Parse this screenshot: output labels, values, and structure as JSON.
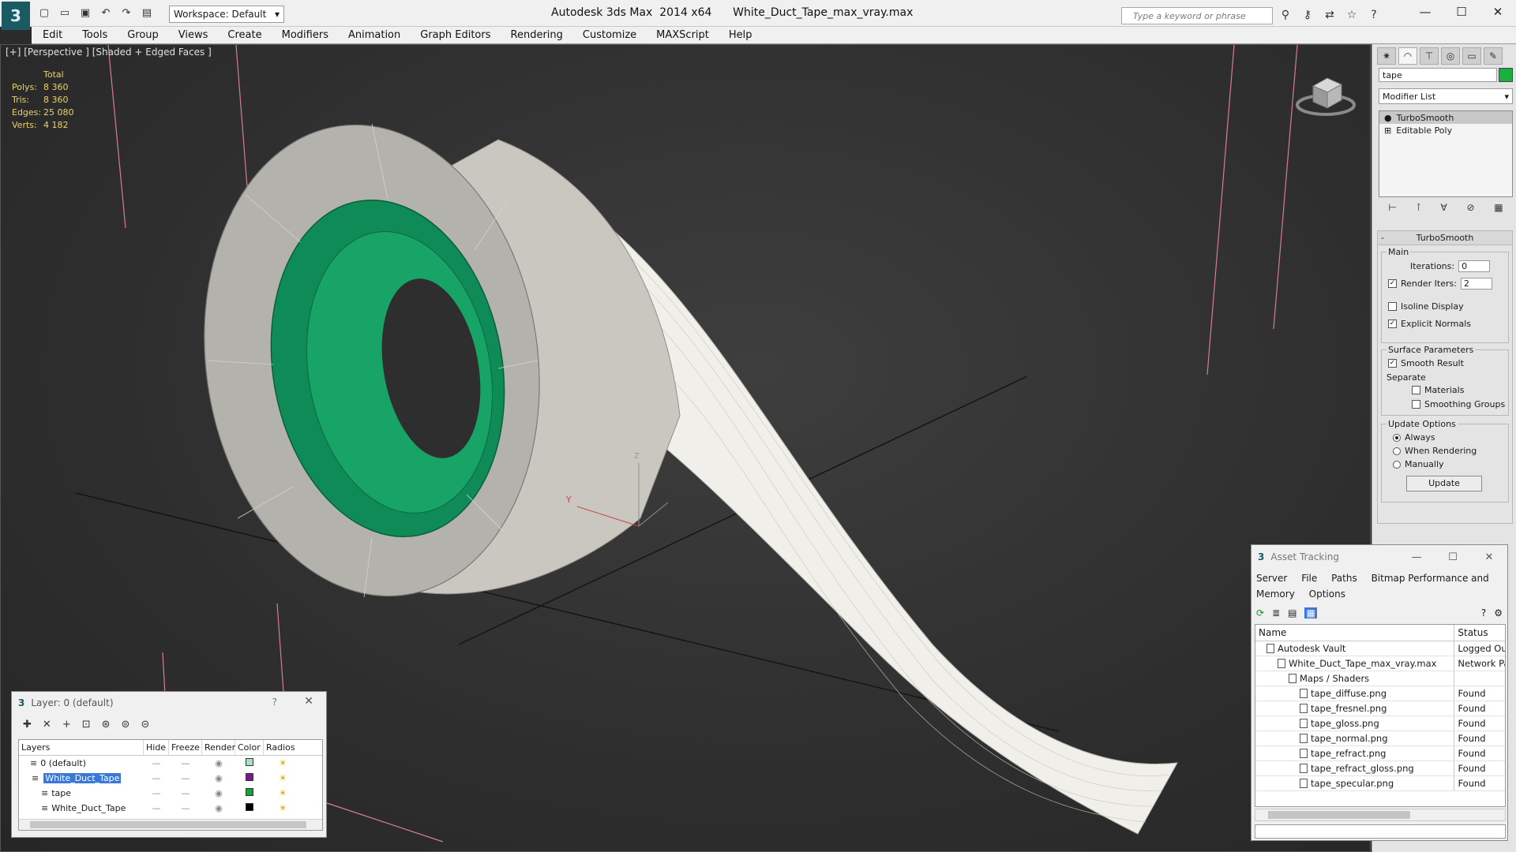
{
  "title": {
    "app": "Autodesk 3ds Max  2014 x64",
    "file": "White_Duct_Tape_max_vray.max",
    "workspace": "Workspace: Default",
    "search_placeholder": "Type a keyword or phrase"
  },
  "menu": [
    "Edit",
    "Tools",
    "Group",
    "Views",
    "Create",
    "Modifiers",
    "Animation",
    "Graph Editors",
    "Rendering",
    "Customize",
    "MAXScript",
    "Help"
  ],
  "viewport": {
    "label": "[+] [Perspective ] [Shaded + Edged Faces ]",
    "stats": {
      "total": "Total",
      "polys_label": "Polys:",
      "polys": "8 360",
      "tris_label": "Tris:",
      "tris": "8 360",
      "edges_label": "Edges:",
      "edges": "25 080",
      "verts_label": "Verts:",
      "verts": "4 182"
    },
    "gizmo_y": "Y",
    "gizmo_z": "Z"
  },
  "command_panel": {
    "object_name": "tape",
    "object_color": "#18b040",
    "modifier_list": "Modifier List",
    "stack": [
      "TurboSmooth",
      "Editable Poly"
    ],
    "rollout_title": "TurboSmooth",
    "main_group": "Main",
    "iterations_label": "Iterations:",
    "iterations": "0",
    "render_iters_label": "Render Iters:",
    "render_iters": "2",
    "isoline": "Isoline Display",
    "explicit_normals": "Explicit Normals",
    "surface_group": "Surface Parameters",
    "smooth_result": "Smooth Result",
    "separate": "Separate",
    "materials": "Materials",
    "smoothing_groups": "Smoothing Groups",
    "update_group": "Update Options",
    "always": "Always",
    "when_rendering": "When Rendering",
    "manually": "Manually",
    "update_btn": "Update"
  },
  "asset_tracking": {
    "title": "Asset Tracking",
    "menu": [
      "Server",
      "File",
      "Paths",
      "Bitmap Performance and Memory",
      "Options"
    ],
    "col_name": "Name",
    "col_status": "Status",
    "rows": [
      {
        "name": "Autodesk Vault",
        "status": "Logged Ou",
        "indent": 1
      },
      {
        "name": "White_Duct_Tape_max_vray.max",
        "status": "Network Pa",
        "indent": 2
      },
      {
        "name": "Maps / Shaders",
        "status": "",
        "indent": 3
      },
      {
        "name": "tape_diffuse.png",
        "status": "Found",
        "indent": 4
      },
      {
        "name": "tape_fresnel.png",
        "status": "Found",
        "indent": 4
      },
      {
        "name": "tape_gloss.png",
        "status": "Found",
        "indent": 4
      },
      {
        "name": "tape_normal.png",
        "status": "Found",
        "indent": 4
      },
      {
        "name": "tape_refract.png",
        "status": "Found",
        "indent": 4
      },
      {
        "name": "tape_refract_gloss.png",
        "status": "Found",
        "indent": 4
      },
      {
        "name": "tape_specular.png",
        "status": "Found",
        "indent": 4
      }
    ]
  },
  "layers": {
    "title": "Layer: 0 (default)",
    "help": "?",
    "columns": [
      "Layers",
      "Hide",
      "Freeze",
      "Render",
      "Color",
      "Radios"
    ],
    "rows": [
      {
        "name": "0 (default)",
        "color": "#a8e0c0",
        "selected": false,
        "indent": 1
      },
      {
        "name": "White_Duct_Tape",
        "color": "#7a1a8a",
        "selected": true,
        "indent": 1
      },
      {
        "name": "tape",
        "color": "#18a040",
        "selected": false,
        "indent": 2
      },
      {
        "name": "White_Duct_Tape",
        "color": "#000000",
        "selected": false,
        "indent": 2
      }
    ]
  }
}
